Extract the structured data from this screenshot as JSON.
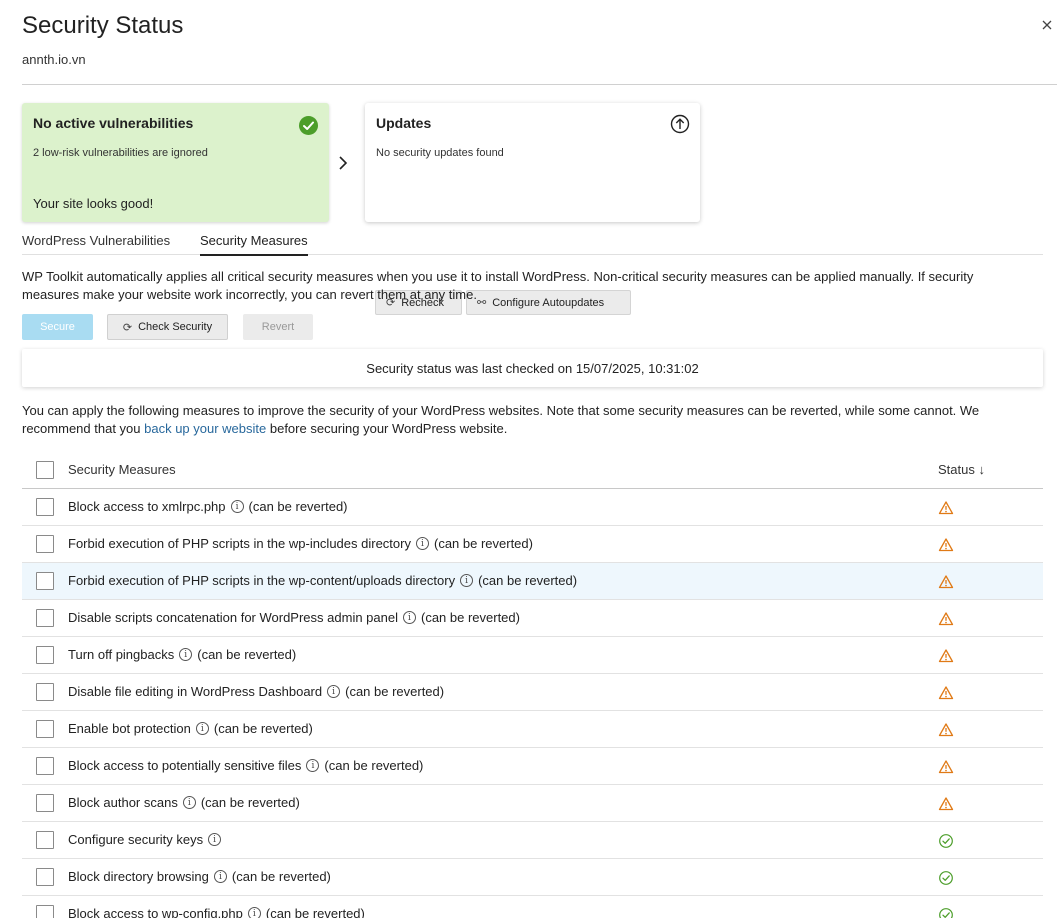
{
  "header": {
    "title": "Security Status",
    "subtitle": "annth.io.vn"
  },
  "vuln_card": {
    "title": "No active vulnerabilities",
    "text": "2 low-risk vulnerabilities are ignored",
    "footer": "Your site looks good!",
    "color": "#dcf2cc"
  },
  "updates_card": {
    "title": "Updates",
    "text": "No security updates found",
    "recheck_label": "Recheck",
    "autoupdates_label": "Configure Autoupdates"
  },
  "tabs": [
    {
      "label": "WordPress Vulnerabilities"
    },
    {
      "label": "Security Measures",
      "active": true
    }
  ],
  "intro_text": "WP Toolkit automatically applies all critical security measures when you use it to install WordPress. Non-critical security measures can be applied manually. If security measures make your website work incorrectly, you can revert them at any time.",
  "actions": {
    "secure": "Secure",
    "check": "Check Security",
    "revert": "Revert"
  },
  "last_checked": "Security status was last checked on 15/07/2025, 10:31:02",
  "note": {
    "before": "You can apply the following measures to improve the security of your WordPress websites. Note that some security measures can be reverted, while some cannot. We recommend that you ",
    "link": "back up your website",
    "after": " before securing your WordPress website."
  },
  "table": {
    "col_measures": "Security Measures",
    "col_status": "Status ↓",
    "rows": [
      {
        "label": "Block access to xmlrpc.php",
        "suffix": "(can be reverted)",
        "status": "warning"
      },
      {
        "label": "Forbid execution of PHP scripts in the wp-includes directory",
        "suffix": "(can be reverted)",
        "status": "warning"
      },
      {
        "label": "Forbid execution of PHP scripts in the wp-content/uploads directory",
        "suffix": "(can be reverted)",
        "status": "warning"
      },
      {
        "label": "Disable scripts concatenation for WordPress admin panel",
        "suffix": "(can be reverted)",
        "status": "warning"
      },
      {
        "label": "Turn off pingbacks",
        "suffix": "(can be reverted)",
        "status": "warning"
      },
      {
        "label": "Disable file editing in WordPress Dashboard",
        "suffix": "(can be reverted)",
        "status": "warning"
      },
      {
        "label": "Enable bot protection",
        "suffix": "(can be reverted)",
        "status": "warning"
      },
      {
        "label": "Block access to potentially sensitive files",
        "suffix": "(can be reverted)",
        "status": "warning"
      },
      {
        "label": "Block author scans",
        "suffix": "(can be reverted)",
        "status": "warning"
      },
      {
        "label": "Configure security keys",
        "suffix": "",
        "status": "ok"
      },
      {
        "label": "Block directory browsing",
        "suffix": "(can be reverted)",
        "status": "ok"
      },
      {
        "label": "Block access to wp-config.php",
        "suffix": "(can be reverted)",
        "status": "ok"
      }
    ]
  },
  "colors": {
    "warning": "#e07a16",
    "ok": "#4c9e2a",
    "link": "#28689c",
    "secure_button": "#a9dcf2"
  }
}
